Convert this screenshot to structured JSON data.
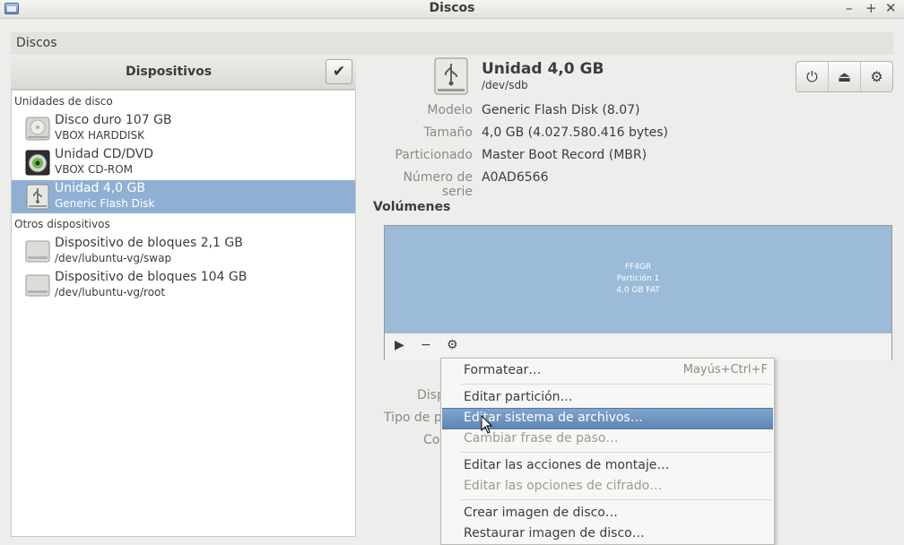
{
  "window": {
    "title": "Discos"
  },
  "menubar": {
    "item": "Discos"
  },
  "sidebar": {
    "header": "Dispositivos",
    "sections": [
      {
        "label": "Unidades de disco"
      },
      {
        "label": "Otros dispositivos"
      }
    ],
    "devices": [
      {
        "name": "Disco duro 107 GB",
        "sub": "VBOX HARDDISK"
      },
      {
        "name": "Unidad CD/DVD",
        "sub": "VBOX CD-ROM"
      },
      {
        "name": "Unidad 4,0 GB",
        "sub": "Generic Flash Disk"
      },
      {
        "name": "Dispositivo de bloques 2,1 GB",
        "sub": "/dev/lubuntu-vg/swap"
      },
      {
        "name": "Dispositivo de bloques 104 GB",
        "sub": "/dev/lubuntu-vg/root"
      }
    ]
  },
  "device": {
    "title": "Unidad 4,0 GB",
    "path": "/dev/sdb",
    "props": [
      {
        "label": "Modelo",
        "value": "Generic Flash Disk (8.07)"
      },
      {
        "label": "Tamaño",
        "value": "4,0 GB (4.027.580.416 bytes)"
      },
      {
        "label": "Particionado",
        "value": "Master Boot Record (MBR)"
      },
      {
        "label": "Número de serie",
        "value": "A0AD6566"
      }
    ]
  },
  "volumes": {
    "header": "Volúmenes",
    "partition": {
      "line1": "FF4GR",
      "line2": "Partición 1",
      "line3": "4,0 GB FAT"
    }
  },
  "hidden_labels": [
    "Disp",
    "Tipo de p",
    "Co"
  ],
  "context_menu": {
    "items": [
      {
        "label": "Formatear…",
        "accel": "Mayús+Ctrl+F"
      },
      {
        "label": "Editar partición…"
      },
      {
        "label": "Editar sistema de archivos…"
      },
      {
        "label": "Cambiar frase de paso…"
      },
      {
        "label": "Editar las acciones de montaje…"
      },
      {
        "label": "Editar las opciones de cifrado…"
      },
      {
        "label": "Crear imagen de disco…"
      },
      {
        "label": "Restaurar imagen de disco…"
      }
    ]
  },
  "colors": {
    "selection": "#8fb0d4",
    "partition": "#9cbbd9",
    "menu_highlight": "#6a91bf"
  }
}
